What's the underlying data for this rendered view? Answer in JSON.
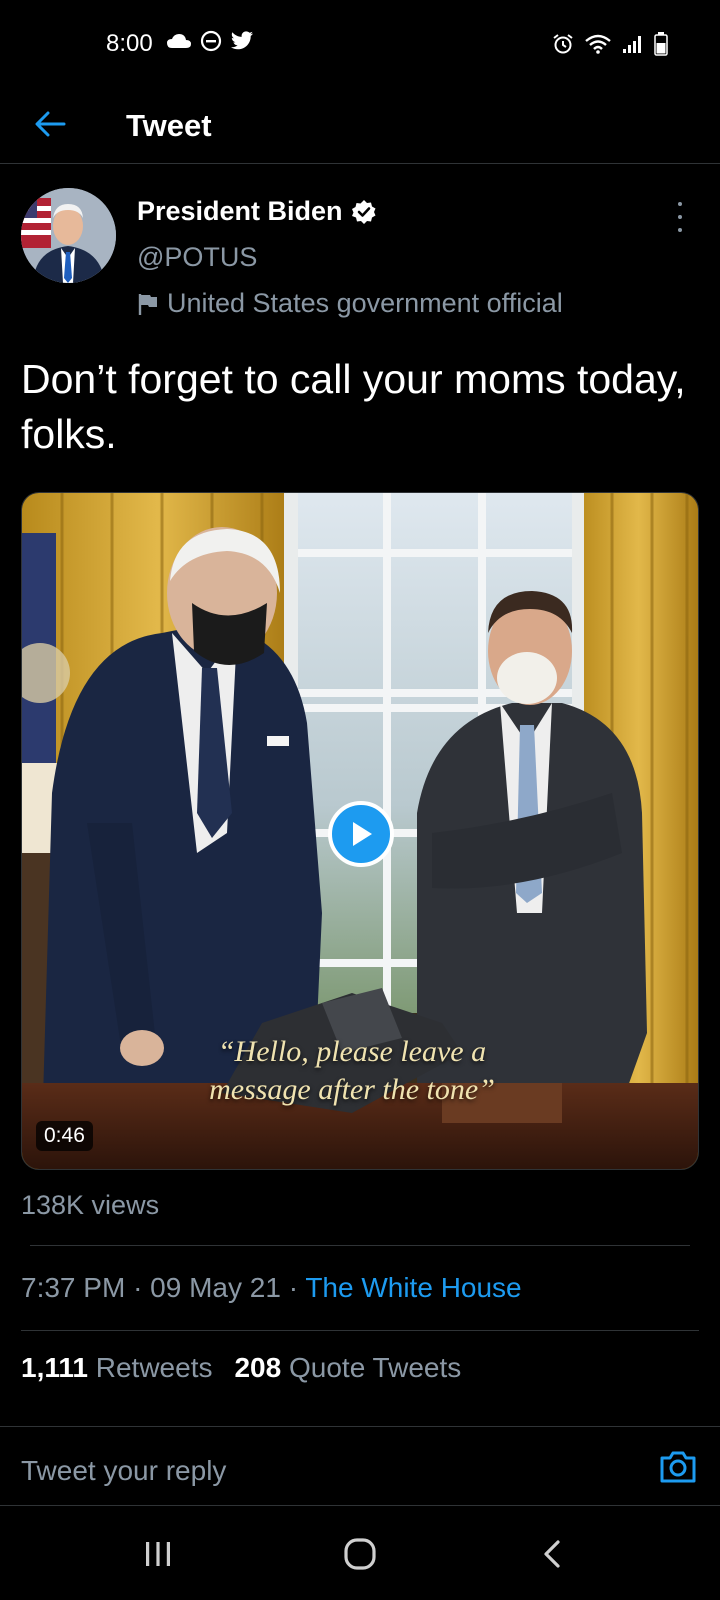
{
  "status_bar": {
    "time": "8:00",
    "left_icons": [
      "cloud-icon",
      "do-not-disturb-icon",
      "twitter-icon"
    ],
    "right_icons": [
      "alarm-icon",
      "wifi-icon",
      "signal-icon",
      "battery-icon"
    ]
  },
  "header": {
    "title": "Tweet",
    "back_icon": "arrow-left-icon",
    "accent_color": "#1d9bf0"
  },
  "tweet": {
    "author": {
      "name": "President Biden",
      "handle": "@POTUS",
      "verified": true,
      "label": "United States government official",
      "label_icon": "flag-icon"
    },
    "text": "Don’t forget to call your moms today, folks.",
    "media": {
      "type": "video",
      "caption": "“Hello, please leave a message after the tone”",
      "duration": "0:46"
    },
    "views": "138K views",
    "time": "7:37 PM",
    "separator": "·",
    "date": "09 May 21",
    "source": "The White House",
    "stats": {
      "retweets_count": "1,111",
      "retweets_label": "Retweets",
      "quotes_count": "208",
      "quotes_label": "Quote Tweets"
    }
  },
  "reply": {
    "placeholder": "Tweet your reply",
    "camera_icon": "camera-icon"
  },
  "nav_bar": {
    "buttons": [
      "recent-apps-icon",
      "home-icon",
      "back-icon"
    ]
  }
}
